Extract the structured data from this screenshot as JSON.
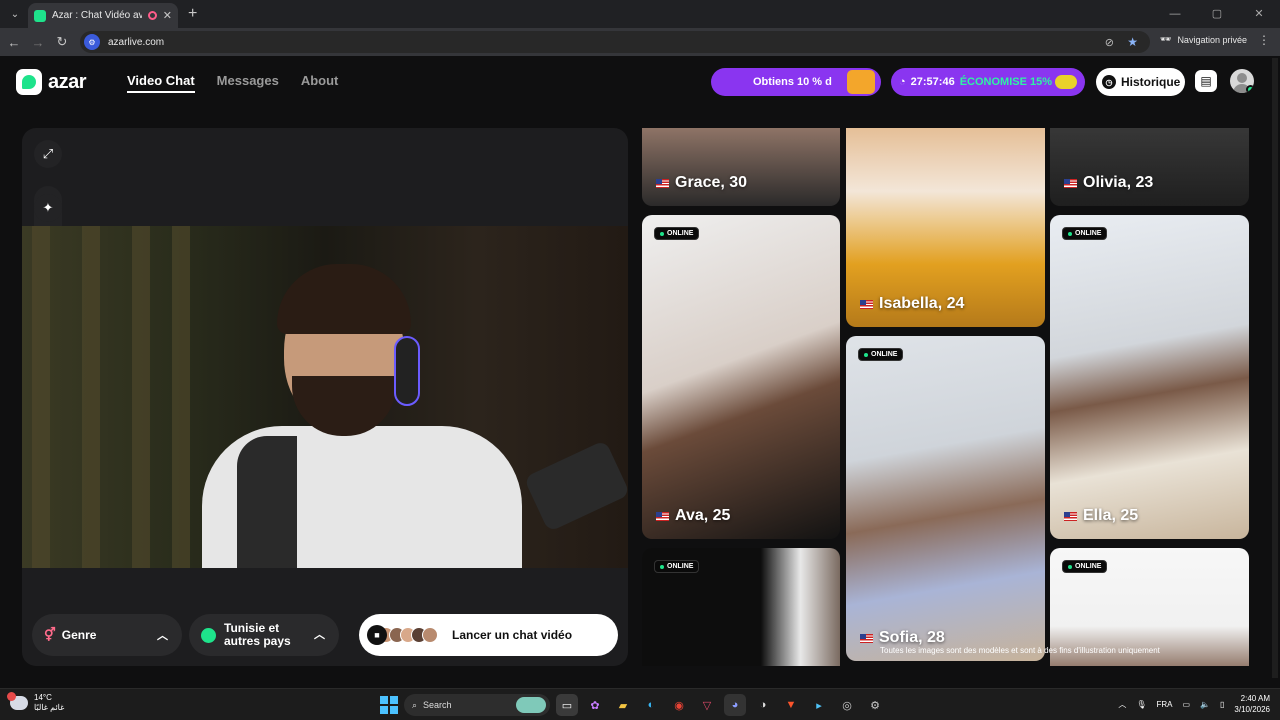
{
  "browser": {
    "tab_title": "Azar : Chat Vidéo avec de n",
    "url": "azarlive.com",
    "incognito_label": "Navigation privée"
  },
  "header": {
    "logo_text": "azar",
    "nav": [
      "Video Chat",
      "Messages",
      "About"
    ],
    "promo1_text": "Obtiens 10 % d",
    "promo2_timer": "27:57:46",
    "promo2_text": "ÉCONOMISE 15%",
    "history_label": "Historique"
  },
  "video_panel": {
    "genre_label": "Genre",
    "country_label": "Tunisie et autres pays",
    "launch_label": "Lancer un chat vidéo"
  },
  "profiles": [
    {
      "name": "Grace, 30",
      "online": false
    },
    {
      "name": "Isabella, 24",
      "online": false
    },
    {
      "name": "Olivia, 23",
      "online": false
    },
    {
      "name": "Ava, 25",
      "online": true
    },
    {
      "name": "Sofia, 28",
      "online": true
    },
    {
      "name": "Ella, 25",
      "online": true
    },
    {
      "name": "",
      "online": true
    },
    {
      "name": "",
      "online": true
    }
  ],
  "online_badge": "ONLINE",
  "disclaimer": "Toutes les images sont des modèles et sont à des fins d'illustration uniquement",
  "taskbar": {
    "weather_temp": "14°C",
    "weather_desc": "غائم غالبًا",
    "search_placeholder": "Search",
    "lang": "FRA",
    "time": "2:40 AM",
    "date": "3/10/2026"
  },
  "colors": {
    "accent_green": "#1ee38b",
    "promo_purple": "#8a35f0"
  }
}
